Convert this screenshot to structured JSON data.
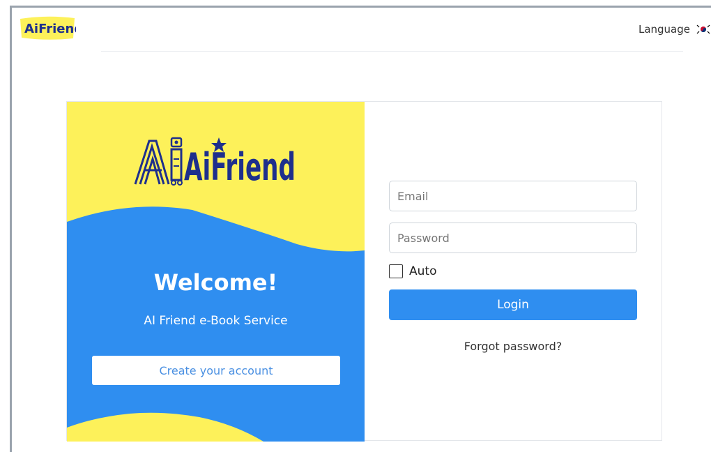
{
  "header": {
    "logo_text": "AiFriend",
    "language_label": "Language",
    "language_flag_icon": "korea-flag-icon"
  },
  "welcome_panel": {
    "brand_logo_text": "AiFriend",
    "title": "Welcome!",
    "subtitle": "AI Friend e-Book Service",
    "create_account_label": "Create your account"
  },
  "login_form": {
    "email_placeholder": "Email",
    "email_value": "",
    "password_placeholder": "Password",
    "password_value": "",
    "auto_label": "Auto",
    "auto_checked": false,
    "login_label": "Login",
    "forgot_label": "Forgot password?"
  },
  "colors": {
    "brand_blue": "#2f8ef0",
    "brand_yellow": "#fdf15a",
    "logo_navy": "#1e2f8c"
  }
}
